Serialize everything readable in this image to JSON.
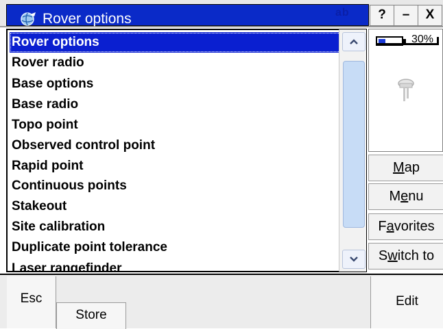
{
  "window": {
    "title": "Rover options",
    "input_indicator": "ab",
    "help_label": "?",
    "minimize_label": "–",
    "close_label": "X"
  },
  "list": {
    "selected_index": 0,
    "items": [
      "Rover options",
      "Rover radio",
      "Base options",
      "Base radio",
      "Topo point",
      "Observed control point",
      "Rapid point",
      "Continuous points",
      "Stakeout",
      "Site calibration",
      "Duplicate point tolerance",
      "Laser rangefinder"
    ]
  },
  "status": {
    "battery_percent": "30%",
    "battery_level": 0.3,
    "icons": [
      "battery-icon",
      "rover-receiver-icon"
    ]
  },
  "side_buttons": {
    "map": {
      "pre": "",
      "ul": "M",
      "post": "ap"
    },
    "menu": {
      "pre": "M",
      "ul": "e",
      "post": "nu"
    },
    "favorites": {
      "pre": "F",
      "ul": "a",
      "post": "vorites"
    },
    "switch_to": {
      "pre": "S",
      "ul": "w",
      "post": "itch to"
    }
  },
  "bottom": {
    "esc_label": "Esc",
    "store_label": "Store",
    "edit_label": "Edit"
  },
  "colors": {
    "title_bar": "#0a2ac8",
    "selection": "#0a1fd0",
    "scroll_thumb": "#c7dcf6"
  }
}
